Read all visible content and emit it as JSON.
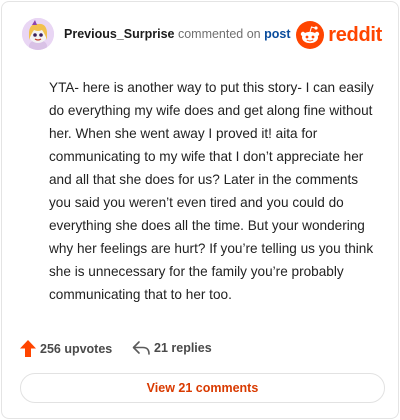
{
  "header": {
    "username": "Previous_Surprise",
    "commented_text": "commented on",
    "post_link": "post",
    "brand": "reddit"
  },
  "comment": {
    "body": "YTA- here is another way to put this story- I can easily do everything my wife does and get along fine without her. When she went away I proved it! aita for communicating to my wife that I don’t appreciate her and all that she does for us? Later in the comments you said you weren’t even tired and you could do everything she does all the time. But your wondering why her feelings are hurt? If you’re telling us you think she is unnecessary for the family you’re probably communicating that to her too."
  },
  "actions": {
    "upvotes": "256 upvotes",
    "replies": "21 replies"
  },
  "view_button": {
    "label": "View 21 comments"
  },
  "colors": {
    "brand": "#ff4500",
    "link": "#0a4c9c",
    "button_text": "#d93a00"
  },
  "icons": {
    "avatar": "snoo-avatar-icon",
    "brand": "reddit-logo-icon",
    "upvote": "upvote-arrow-icon",
    "reply": "reply-arrow-icon"
  }
}
